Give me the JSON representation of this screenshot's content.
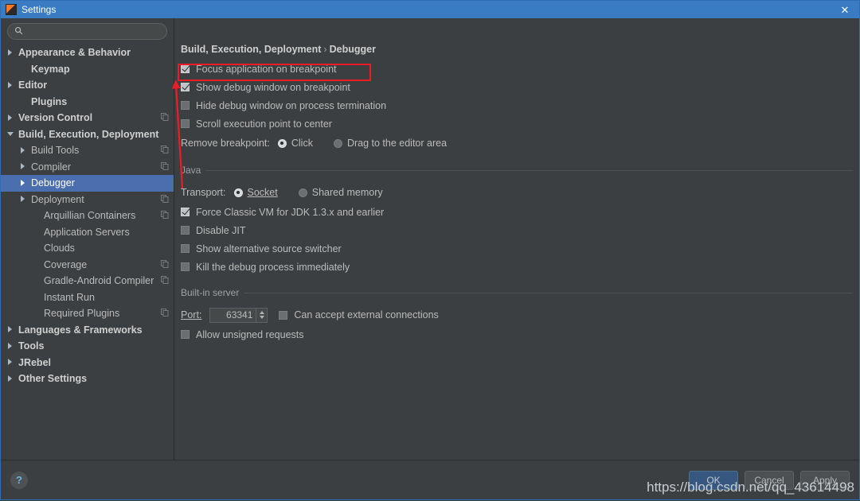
{
  "window": {
    "title": "Settings",
    "icon": "intellij-idea-icon",
    "close_label": "✕"
  },
  "search": {
    "value": "",
    "placeholder": "",
    "icon": "search-icon"
  },
  "sidebar": {
    "items": [
      {
        "label": "Appearance & Behavior",
        "indent": 0,
        "arrow": "right",
        "bold": true,
        "copy": false,
        "selected": false
      },
      {
        "label": "Keymap",
        "indent": 1,
        "arrow": "none",
        "bold": true,
        "copy": false,
        "selected": false
      },
      {
        "label": "Editor",
        "indent": 0,
        "arrow": "right",
        "bold": true,
        "copy": false,
        "selected": false
      },
      {
        "label": "Plugins",
        "indent": 1,
        "arrow": "none",
        "bold": true,
        "copy": false,
        "selected": false
      },
      {
        "label": "Version Control",
        "indent": 0,
        "arrow": "right",
        "bold": true,
        "copy": true,
        "selected": false
      },
      {
        "label": "Build, Execution, Deployment",
        "indent": 0,
        "arrow": "down",
        "bold": true,
        "copy": false,
        "selected": false
      },
      {
        "label": "Build Tools",
        "indent": 1,
        "arrow": "right",
        "bold": false,
        "copy": true,
        "selected": false
      },
      {
        "label": "Compiler",
        "indent": 1,
        "arrow": "right",
        "bold": false,
        "copy": true,
        "selected": false
      },
      {
        "label": "Debugger",
        "indent": 1,
        "arrow": "right",
        "bold": false,
        "copy": false,
        "selected": true
      },
      {
        "label": "Deployment",
        "indent": 1,
        "arrow": "right",
        "bold": false,
        "copy": true,
        "selected": false
      },
      {
        "label": "Arquillian Containers",
        "indent": 2,
        "arrow": "none",
        "bold": false,
        "copy": true,
        "selected": false
      },
      {
        "label": "Application Servers",
        "indent": 2,
        "arrow": "none",
        "bold": false,
        "copy": false,
        "selected": false
      },
      {
        "label": "Clouds",
        "indent": 2,
        "arrow": "none",
        "bold": false,
        "copy": false,
        "selected": false
      },
      {
        "label": "Coverage",
        "indent": 2,
        "arrow": "none",
        "bold": false,
        "copy": true,
        "selected": false
      },
      {
        "label": "Gradle-Android Compiler",
        "indent": 2,
        "arrow": "none",
        "bold": false,
        "copy": true,
        "selected": false
      },
      {
        "label": "Instant Run",
        "indent": 2,
        "arrow": "none",
        "bold": false,
        "copy": false,
        "selected": false
      },
      {
        "label": "Required Plugins",
        "indent": 2,
        "arrow": "none",
        "bold": false,
        "copy": true,
        "selected": false
      },
      {
        "label": "Languages & Frameworks",
        "indent": 0,
        "arrow": "right",
        "bold": true,
        "copy": false,
        "selected": false
      },
      {
        "label": "Tools",
        "indent": 0,
        "arrow": "right",
        "bold": true,
        "copy": false,
        "selected": false
      },
      {
        "label": "JRebel",
        "indent": 0,
        "arrow": "right",
        "bold": true,
        "copy": false,
        "selected": false
      },
      {
        "label": "Other Settings",
        "indent": 0,
        "arrow": "right",
        "bold": true,
        "copy": false,
        "selected": false
      }
    ]
  },
  "main": {
    "breadcrumb": {
      "parent": "Build, Execution, Deployment",
      "separator": "›",
      "current": "Debugger"
    },
    "top_checkboxes": [
      {
        "label": "Focus application on breakpoint",
        "checked": true,
        "name": "focus-application-on-breakpoint"
      },
      {
        "label": "Show debug window on breakpoint",
        "checked": true,
        "name": "show-debug-window-on-breakpoint"
      },
      {
        "label": "Hide debug window on process termination",
        "checked": false,
        "name": "hide-debug-window-on-process-termination"
      },
      {
        "label": "Scroll execution point to center",
        "checked": false,
        "name": "scroll-execution-point-to-center"
      }
    ],
    "remove_breakpoint": {
      "label": "Remove breakpoint:",
      "options": [
        {
          "label": "Click",
          "selected": true
        },
        {
          "label": "Drag to the editor area",
          "selected": false
        }
      ]
    },
    "java_section": {
      "title": "Java",
      "transport": {
        "label": "Transport:",
        "options": [
          {
            "label": "Socket",
            "selected": true
          },
          {
            "label": "Shared memory",
            "selected": false
          }
        ]
      },
      "checkboxes": [
        {
          "label": "Force Classic VM for JDK 1.3.x and earlier",
          "checked": true,
          "name": "force-classic-vm"
        },
        {
          "label": "Disable JIT",
          "checked": false,
          "name": "disable-jit"
        },
        {
          "label": "Show alternative source switcher",
          "checked": false,
          "name": "show-alternative-source-switcher"
        },
        {
          "label": "Kill the debug process immediately",
          "checked": false,
          "name": "kill-debug-process-immediately"
        }
      ]
    },
    "builtin_server": {
      "title": "Built-in server",
      "port_label": "Port:",
      "port_value": "63341",
      "external_connections": {
        "label": "Can accept external connections",
        "checked": false
      },
      "unsigned_requests": {
        "label": "Allow unsigned requests",
        "checked": false
      }
    }
  },
  "footer": {
    "help_label": "?",
    "buttons": [
      {
        "label": "OK",
        "style": "primary"
      },
      {
        "label": "Cancel",
        "style": "normal"
      },
      {
        "label": "Apply",
        "style": "normal"
      }
    ]
  },
  "annotation": {
    "highlight_color": "#ee1c25",
    "watermark": "https://blog.csdn.net/qq_43614498"
  }
}
